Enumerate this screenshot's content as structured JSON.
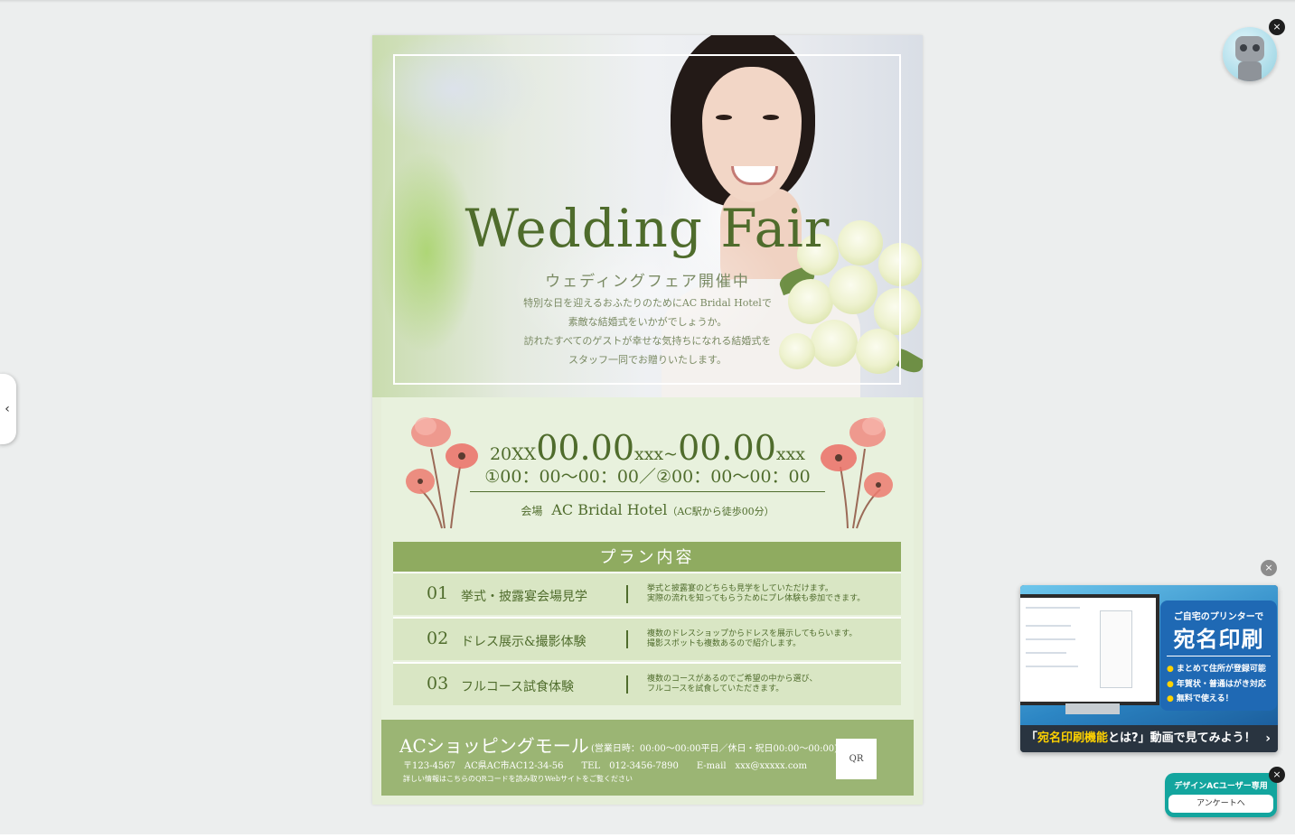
{
  "flyer": {
    "title": "Wedding Fair",
    "subtitle": "ウェディングフェア開催中",
    "description": [
      "特別な日を迎えるおふたりのためにAC Bridal Hotelで",
      "素敵な結婚式をいかがでしょうか。",
      "訪れたすべてのゲストが幸せな気持ちになれる結婚式を",
      "スタッフ一同でお贈りいたします。"
    ],
    "date": {
      "year": "20XX",
      "start": "00.00",
      "start_suffix": "xxx",
      "separator": "~",
      "end": "00.00",
      "end_suffix": "xxx"
    },
    "time": "①00：00〜00：00／②00：00〜00：00",
    "venue": {
      "label": "会場",
      "name": "AC Bridal Hotel",
      "note": "（AC駅から徒歩00分）"
    },
    "plan": {
      "heading": "プラン内容",
      "items": [
        {
          "number": "01",
          "name": "挙式・披露宴会場見学",
          "desc1": "挙式と披露宴のどちらも見学をしていただけます。",
          "desc2": "実際の流れを知ってもらうためにプレ体験も参加できます。"
        },
        {
          "number": "02",
          "name": "ドレス展示&撮影体験",
          "desc1": "複数のドレスショップからドレスを展示してもらいます。",
          "desc2": "撮影スポットも複数あるので紹介します。"
        },
        {
          "number": "03",
          "name": "フルコース試食体験",
          "desc1": "複数のコースがあるのでご希望の中から選び、",
          "desc2": "フルコースを試食していただきます。"
        }
      ]
    },
    "footer": {
      "shop_name": "ACショッピングモール",
      "hours": "(営業日時：00:00〜00:00平日／休日・祝日00:00〜00:00)",
      "info": "〒123-4567　AC県AC市AC12-34-56　　TEL　012-3456-7890　　E-mail　xxx@xxxxx.com",
      "note": "詳しい情報はこちらのQRコードを読み取りWebサイトをご覧ください",
      "qr_label": "QR"
    }
  },
  "side_toggle": {
    "label": "‹"
  },
  "ui": {
    "close_glyph": "×"
  },
  "ad": {
    "headline_small": "ご自宅のプリンターで",
    "headline_big": "宛名印刷",
    "bullets": [
      "まとめて住所が登録可能",
      "年賀状・普通はがき対応",
      "無料で使える！"
    ],
    "cta_prefix": "「",
    "cta_highlight": "宛名印刷機能",
    "cta_rest": "とは?」動画で見てみよう！",
    "cta_arrow": "›"
  },
  "survey": {
    "title": "デザインACユーザー専用",
    "button": "アンケートへ"
  },
  "colors": {
    "flyer_green": "#4f6c2c",
    "plan_header": "#8fab60",
    "footer": "#9bb574",
    "survey": "#13a59e",
    "ad_blue": "#1f69b4",
    "ad_yellow": "#ffd200"
  }
}
